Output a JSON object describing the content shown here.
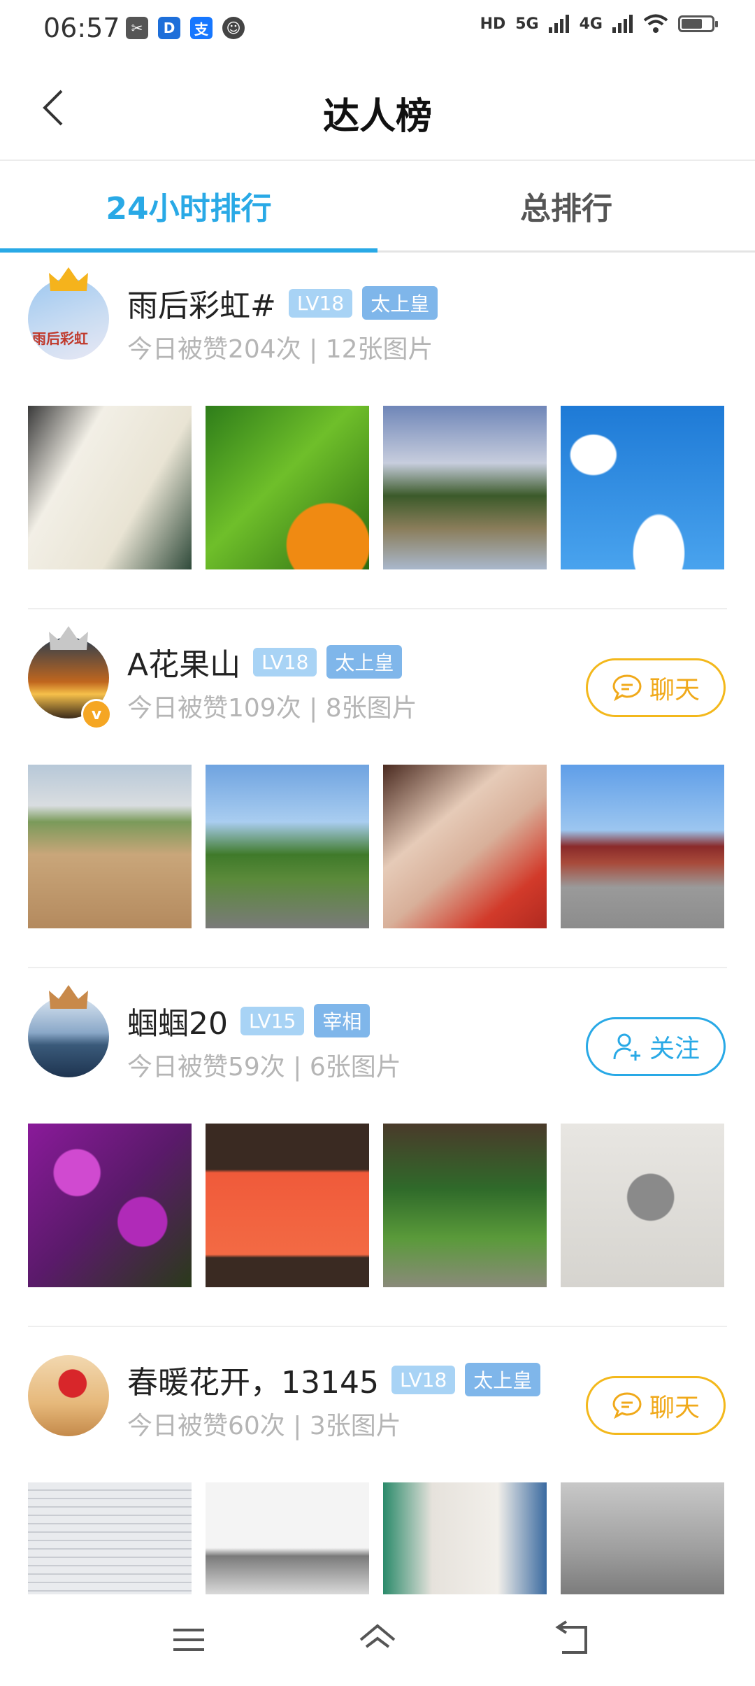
{
  "status_bar": {
    "time": "06:57",
    "network_labels": [
      "HD",
      "5G",
      "4G"
    ],
    "battery_level": 0.7
  },
  "header": {
    "title": "达人榜"
  },
  "tabs": [
    {
      "label": "24小时排行",
      "active": true
    },
    {
      "label": "总排行",
      "active": false
    }
  ],
  "users": [
    {
      "name": "雨后彩虹#",
      "level": "LV18",
      "title": "太上皇",
      "stats": "今日被赞204次 | 12张图片",
      "action": null,
      "crown": "gold",
      "avatar_text": "雨后彩虹"
    },
    {
      "name": "A花果山",
      "level": "LV18",
      "title": "太上皇",
      "stats": "今日被赞109次 | 8张图片",
      "action": "chat",
      "crown": "silver",
      "verified": "v"
    },
    {
      "name": "蝈蝈20",
      "level": "LV15",
      "title": "宰相",
      "stats": "今日被赞59次 | 6张图片",
      "action": "follow",
      "crown": "bronze"
    },
    {
      "name": "春暖花开，13145",
      "level": "LV18",
      "title": "太上皇",
      "stats": "今日被赞60次 | 3张图片",
      "action": "chat",
      "crown": null
    }
  ],
  "actions": {
    "chat_label": "聊天",
    "follow_label": "关注"
  },
  "colors": {
    "accent": "#29a9e6",
    "chat": "#f3b81c",
    "level_badge": "#a8d3f5",
    "title_badge": "#7fb6ea"
  }
}
